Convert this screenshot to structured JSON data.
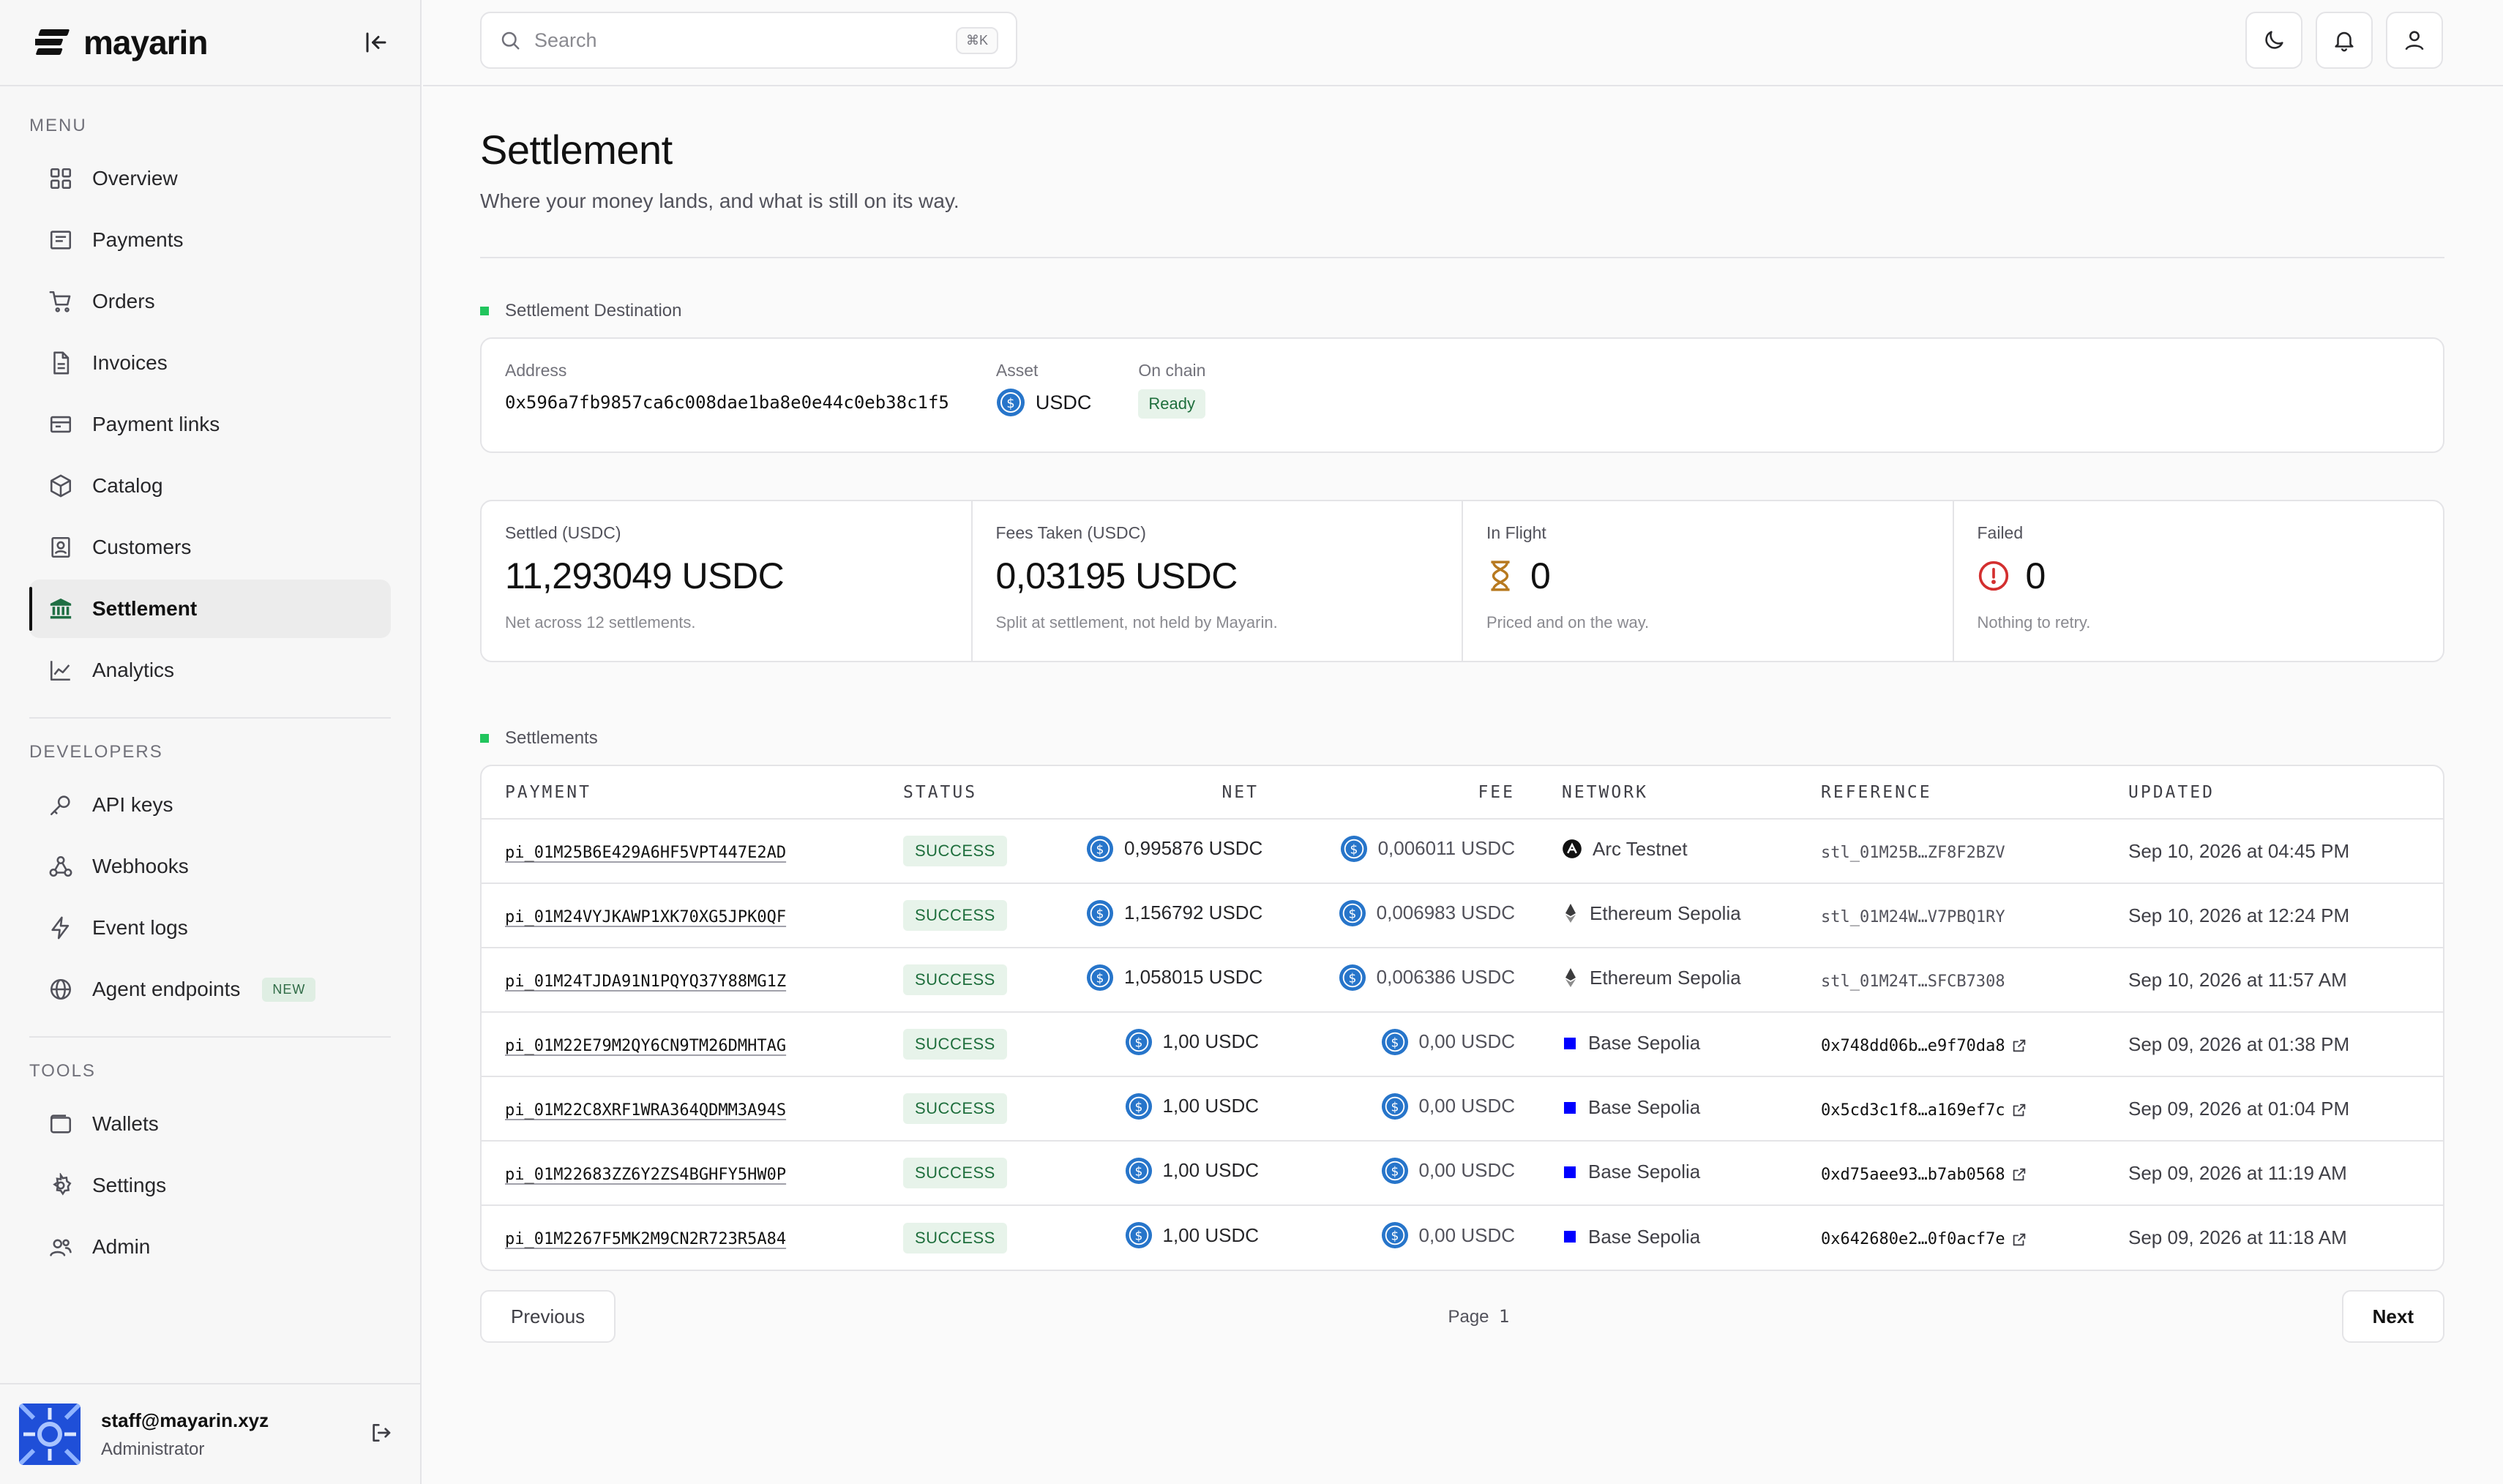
{
  "brand": {
    "name": "mayarin"
  },
  "sidebar": {
    "menu_label": "MENU",
    "developers_label": "DEVELOPERS",
    "tools_label": "TOOLS",
    "menu": [
      {
        "label": "Overview",
        "icon": "grid-icon"
      },
      {
        "label": "Payments",
        "icon": "receipt-icon"
      },
      {
        "label": "Orders",
        "icon": "cart-icon"
      },
      {
        "label": "Invoices",
        "icon": "file-icon"
      },
      {
        "label": "Payment links",
        "icon": "link-card-icon"
      },
      {
        "label": "Catalog",
        "icon": "box-icon"
      },
      {
        "label": "Customers",
        "icon": "contact-icon"
      },
      {
        "label": "Settlement",
        "icon": "bank-icon",
        "active": true
      },
      {
        "label": "Analytics",
        "icon": "chart-line-icon"
      }
    ],
    "developers": [
      {
        "label": "API keys",
        "icon": "key-icon"
      },
      {
        "label": "Webhooks",
        "icon": "webhook-icon"
      },
      {
        "label": "Event logs",
        "icon": "bolt-icon"
      },
      {
        "label": "Agent endpoints",
        "icon": "globe-icon",
        "badge": "NEW"
      }
    ],
    "tools": [
      {
        "label": "Wallets",
        "icon": "wallet-icon"
      },
      {
        "label": "Settings",
        "icon": "gear-icon"
      },
      {
        "label": "Admin",
        "icon": "users-icon"
      }
    ],
    "user": {
      "email": "staff@mayarin.xyz",
      "role": "Administrator"
    }
  },
  "topbar": {
    "search_placeholder": "Search",
    "search_value": "",
    "shortcut": "⌘K"
  },
  "page": {
    "title": "Settlement",
    "subtitle": "Where your money lands, and what is still on its way."
  },
  "destination": {
    "section_label": "Settlement Destination",
    "address_label": "Address",
    "address": "0x596a7fb9857ca6c008dae1ba8e0e44c0eb38c1f5",
    "asset_label": "Asset",
    "asset": "USDC",
    "onchain_label": "On chain",
    "onchain_status": "Ready"
  },
  "stats": [
    {
      "label": "Settled (USDC)",
      "value": "11,293049 USDC",
      "note": "Net across 12 settlements."
    },
    {
      "label": "Fees Taken (USDC)",
      "value": "0,03195 USDC",
      "note": "Split at settlement, not held by Mayarin."
    },
    {
      "label": "In Flight",
      "value": "0",
      "note": "Priced and on the way."
    },
    {
      "label": "Failed",
      "value": "0",
      "note": "Nothing to retry."
    }
  ],
  "settlements": {
    "section_label": "Settlements",
    "columns": [
      "PAYMENT",
      "STATUS",
      "NET",
      "FEE",
      "NETWORK",
      "REFERENCE",
      "UPDATED"
    ],
    "rows": [
      {
        "payment": "pi_01M25B6E429A6HF5VPT447E2AD",
        "status": "SUCCESS",
        "net": "0,995876 USDC",
        "fee": "0,006011 USDC",
        "network": "Arc Testnet",
        "network_icon": "arc-icon",
        "reference": "stl_01M25B…ZF8F2BZV",
        "ref_link": false,
        "updated": "Sep 10, 2026 at 04:45 PM"
      },
      {
        "payment": "pi_01M24VYJKAWP1XK70XG5JPK0QF",
        "status": "SUCCESS",
        "net": "1,156792 USDC",
        "fee": "0,006983 USDC",
        "network": "Ethereum Sepolia",
        "network_icon": "ethereum-icon",
        "reference": "stl_01M24W…V7PBQ1RY",
        "ref_link": false,
        "updated": "Sep 10, 2026 at 12:24 PM"
      },
      {
        "payment": "pi_01M24TJDA91N1PQYQ37Y88MG1Z",
        "status": "SUCCESS",
        "net": "1,058015 USDC",
        "fee": "0,006386 USDC",
        "network": "Ethereum Sepolia",
        "network_icon": "ethereum-icon",
        "reference": "stl_01M24T…SFCB7308",
        "ref_link": false,
        "updated": "Sep 10, 2026 at 11:57 AM"
      },
      {
        "payment": "pi_01M22E79M2QY6CN9TM26DMHTAG",
        "status": "SUCCESS",
        "net": "1,00 USDC",
        "fee": "0,00 USDC",
        "network": "Base Sepolia",
        "network_icon": "base-icon",
        "reference": "0x748dd06b…e9f70da8",
        "ref_link": true,
        "updated": "Sep 09, 2026 at 01:38 PM"
      },
      {
        "payment": "pi_01M22C8XRF1WRA364QDMM3A94S",
        "status": "SUCCESS",
        "net": "1,00 USDC",
        "fee": "0,00 USDC",
        "network": "Base Sepolia",
        "network_icon": "base-icon",
        "reference": "0x5cd3c1f8…a169ef7c",
        "ref_link": true,
        "updated": "Sep 09, 2026 at 01:04 PM"
      },
      {
        "payment": "pi_01M22683ZZ6Y2ZS4BGHFY5HW0P",
        "status": "SUCCESS",
        "net": "1,00 USDC",
        "fee": "0,00 USDC",
        "network": "Base Sepolia",
        "network_icon": "base-icon",
        "reference": "0xd75aee93…b7ab0568",
        "ref_link": true,
        "updated": "Sep 09, 2026 at 11:19 AM"
      },
      {
        "payment": "pi_01M2267F5MK2M9CN2R723R5A84",
        "status": "SUCCESS",
        "net": "1,00 USDC",
        "fee": "0,00 USDC",
        "network": "Base Sepolia",
        "network_icon": "base-icon",
        "reference": "0x642680e2…0f0acf7e",
        "ref_link": true,
        "updated": "Sep 09, 2026 at 11:18 AM"
      }
    ]
  },
  "pagination": {
    "previous_label": "Previous",
    "page_label": "Page",
    "page": "1",
    "next_label": "Next"
  },
  "colors": {
    "accent": "#21c55d",
    "success_bg": "#e7f3ea",
    "success_text": "#1e6e3c",
    "usdc_blue": "#2775ca",
    "base_blue": "#0000ff",
    "danger": "#d32f2f",
    "warn": "#b7791f"
  }
}
